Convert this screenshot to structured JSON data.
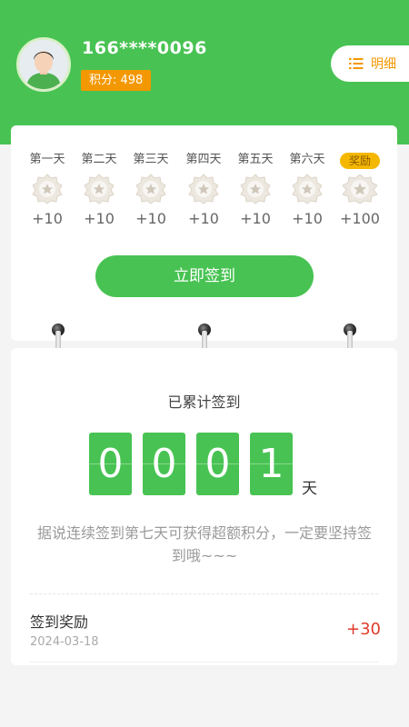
{
  "user": {
    "phone": "166****0096",
    "points_label": "积分: 498"
  },
  "header": {
    "detail_label": "明细"
  },
  "checkin": {
    "days": [
      {
        "label": "第一天",
        "points": "+10"
      },
      {
        "label": "第二天",
        "points": "+10"
      },
      {
        "label": "第三天",
        "points": "+10"
      },
      {
        "label": "第四天",
        "points": "+10"
      },
      {
        "label": "第五天",
        "points": "+10"
      },
      {
        "label": "第六天",
        "points": "+10"
      },
      {
        "label": "奖励",
        "points": "+100"
      }
    ],
    "button_label": "立即签到"
  },
  "summary": {
    "title": "已累计签到",
    "digits": [
      "0",
      "0",
      "0",
      "1"
    ],
    "unit": "天",
    "tip": "据说连续签到第七天可获得超额积分，一定要坚持签到哦~~~"
  },
  "record": {
    "title": "签到奖励",
    "date": "2024-03-18",
    "points": "+30"
  },
  "colors": {
    "primary": "#48c353",
    "accent": "#f39800",
    "reward_badge": "#f5b800",
    "record_points": "#e03b2a"
  }
}
